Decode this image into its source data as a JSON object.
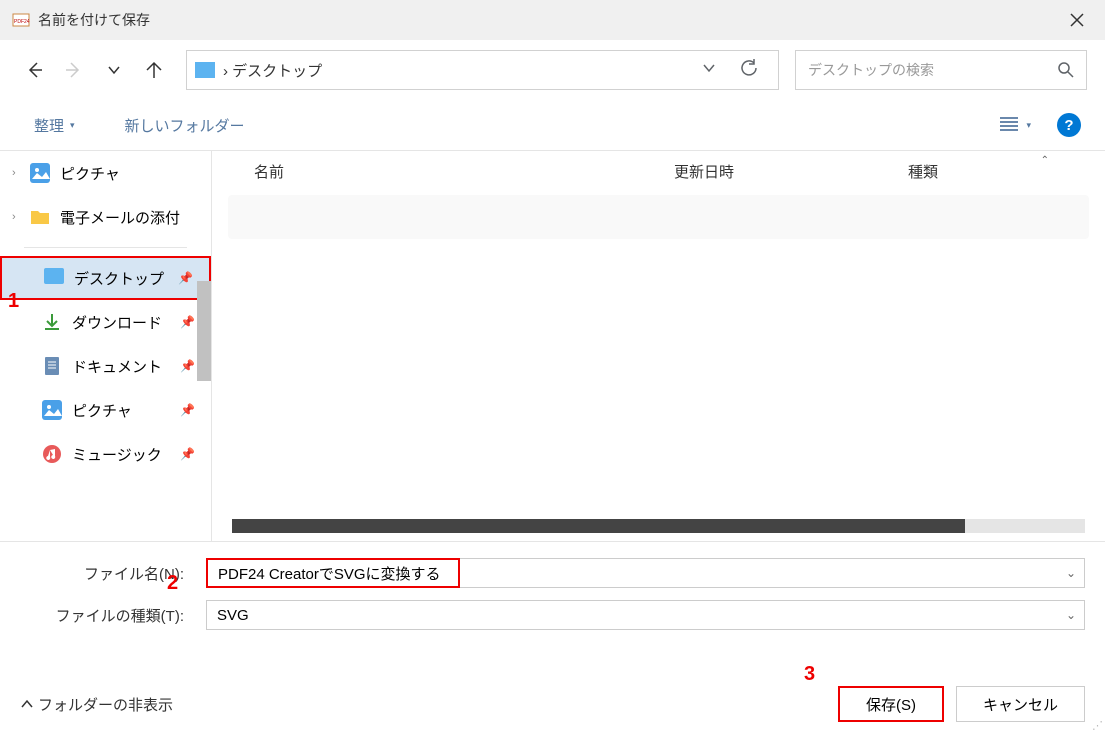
{
  "titlebar": {
    "title": "名前を付けて保存"
  },
  "navbar": {
    "breadcrumb": "› デスクトップ",
    "search_placeholder": "デスクトップの検索"
  },
  "toolbar": {
    "organize": "整理",
    "new_folder": "新しいフォルダー"
  },
  "sidebar": {
    "pictures": "ピクチャ",
    "email_attach": "電子メールの添付",
    "desktop": "デスクトップ",
    "downloads": "ダウンロード",
    "documents": "ドキュメント",
    "pictures2": "ピクチャ",
    "music": "ミュージック"
  },
  "columns": {
    "name": "名前",
    "modified": "更新日時",
    "type": "種類"
  },
  "form": {
    "filename_label": "ファイル名(N):",
    "filename_value": "PDF24 CreatorでSVGに変換する",
    "filetype_label": "ファイルの種類(T):",
    "filetype_value": "SVG"
  },
  "footer": {
    "hide_folders": "フォルダーの非表示",
    "save": "保存(S)",
    "cancel": "キャンセル"
  },
  "annotations": {
    "a1": "1",
    "a2": "2",
    "a3": "3"
  }
}
